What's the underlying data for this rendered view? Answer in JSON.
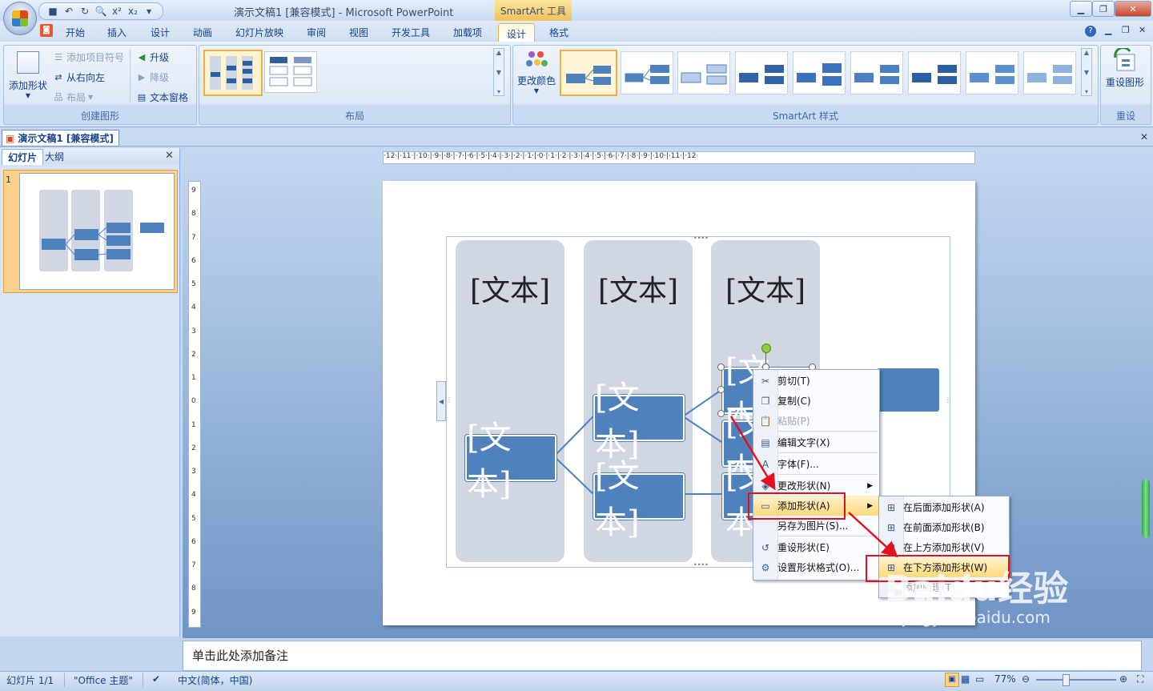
{
  "titlebar": {
    "window_title": "演示文稿1 [兼容模式] - Microsoft PowerPoint",
    "context_tools_title": "SmartArt 工具",
    "qat_icons": [
      "save-icon",
      "undo-icon",
      "redo-icon",
      "print-preview-icon",
      "superscript-icon",
      "subscript-icon"
    ]
  },
  "tabs": {
    "items": [
      "开始",
      "插入",
      "设计",
      "动画",
      "幻灯片放映",
      "审阅",
      "视图",
      "开发工具",
      "加载项",
      "设计",
      "格式"
    ]
  },
  "ribbon": {
    "create_group": {
      "label": "创建图形",
      "add_shape": "添加形状",
      "add_bullet": "添加项目符号",
      "right_to_left": "从右向左",
      "layout": "布局",
      "promote": "升级",
      "demote": "降级",
      "text_pane": "文本窗格"
    },
    "layouts_group": {
      "label": "布局"
    },
    "styles_group": {
      "label": "SmartArt 样式",
      "change_colors": "更改颜色"
    },
    "reset_group": {
      "label": "重设",
      "reset_graphic": "重设图形"
    }
  },
  "document": {
    "tab_title": "演示文稿1 [兼容模式]"
  },
  "left_pane": {
    "tab_slides": "幻灯片",
    "tab_outline": "大纲",
    "slide_number": "1"
  },
  "ruler": {
    "h_labels": "·12·|·11·|·10·|·9·|·8·|·7·|·6·|·5·|·4·|·3·|·2·|·1·|·0·|·1·|·2·|·3·|·4·|·5·|·6·|·7·|·8·|·9·|·10·|·11·|·12·",
    "v_labels": [
      "9",
      "8",
      "7",
      "6",
      "5",
      "4",
      "3",
      "2",
      "1",
      "0",
      "1",
      "2",
      "3",
      "4",
      "5",
      "6",
      "7",
      "8",
      "9"
    ]
  },
  "slide": {
    "column_labels": [
      "[文本]",
      "[文本]",
      "[文本]"
    ],
    "node_text": "[文本]"
  },
  "context_menu": {
    "items": [
      {
        "label": "剪切(T)",
        "icon": "scissors-icon"
      },
      {
        "label": "复制(C)",
        "icon": "copy-icon"
      },
      {
        "label": "粘贴(P)",
        "icon": "paste-icon"
      },
      {
        "label": "编辑文字(X)",
        "icon": "edit-text-icon"
      },
      {
        "label": "字体(F)...",
        "icon": "font-icon"
      },
      {
        "label": "更改形状(N)",
        "icon": "change-shape-icon"
      },
      {
        "label": "添加形状(A)",
        "icon": "add-shape-icon"
      },
      {
        "label": "另存为图片(S)...",
        "icon": ""
      },
      {
        "label": "重设形状(E)",
        "icon": "reset-shape-icon"
      },
      {
        "label": "设置形状格式(O)...",
        "icon": "format-shape-icon"
      }
    ]
  },
  "submenu": {
    "items": [
      {
        "label": "在后面添加形状(A)"
      },
      {
        "label": "在前面添加形状(B)"
      },
      {
        "label": "在上方添加形状(V)"
      },
      {
        "label": "在下方添加形状(W)"
      },
      {
        "label": "添加助理(T)"
      }
    ]
  },
  "notes": {
    "placeholder": "单击此处添加备注"
  },
  "status": {
    "slide_info": "幻灯片 1/1",
    "theme": "\"Office 主题\"",
    "language": "中文(简体，中国)",
    "zoom": "77%"
  },
  "watermark": {
    "brand": "Baidu经验",
    "url": "jingyan.baidu.com"
  },
  "colors": {
    "accent": "#4f81bd",
    "highlight": "#e4101f",
    "ribbon": "#dfe9f7"
  }
}
